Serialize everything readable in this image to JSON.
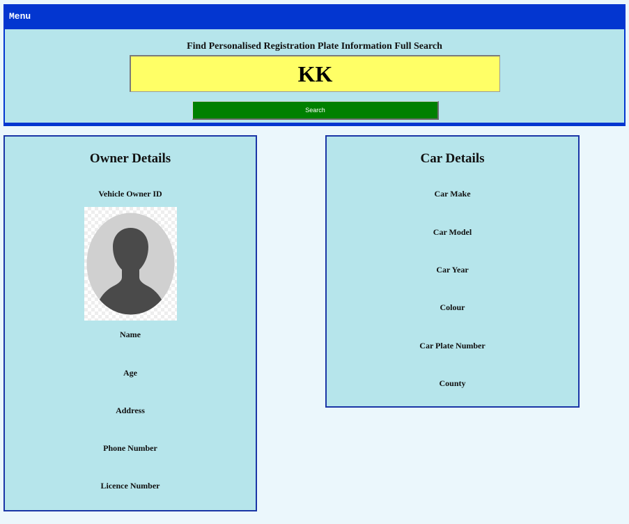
{
  "menu": {
    "label": "Menu"
  },
  "search": {
    "title": "Find Personalised Registration Plate Information Full Search",
    "plate_value": "KK",
    "button_label": "Search"
  },
  "owner": {
    "title": "Owner Details",
    "fields": {
      "vehicle_owner_id": "Vehicle Owner ID",
      "name": "Name",
      "age": "Age",
      "address": "Address",
      "phone_number": "Phone Number",
      "licence_number": "Licence Number"
    },
    "avatar_icon": "person-silhouette-icon"
  },
  "car": {
    "title": "Car Details",
    "fields": {
      "make": "Car Make",
      "model": "Car Model",
      "year": "Car Year",
      "colour": "Colour",
      "plate_number": "Car Plate Number",
      "county": "County"
    }
  },
  "colors": {
    "header_blue": "#0336d0",
    "panel_bg": "#b6e5eb",
    "page_bg": "#ebf7fc",
    "plate_yellow": "#ffff66",
    "search_green": "#008000"
  }
}
